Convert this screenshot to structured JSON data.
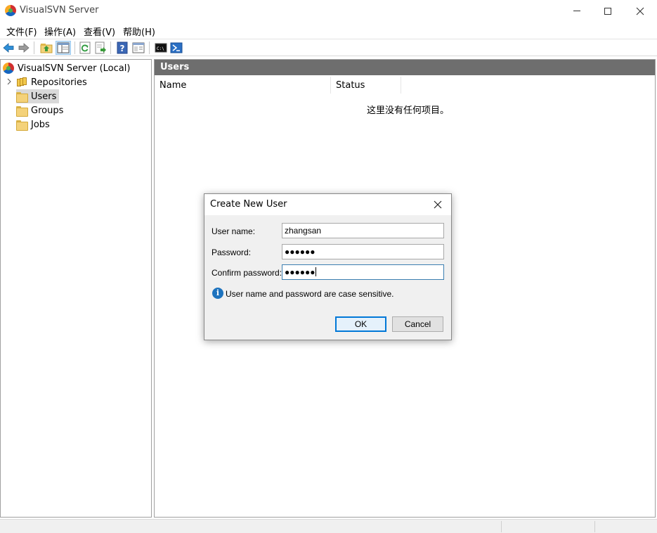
{
  "window": {
    "title": "VisualSVN Server"
  },
  "menu": {
    "items": [
      "文件(F)",
      "操作(A)",
      "查看(V)",
      "帮助(H)"
    ]
  },
  "toolbar": {
    "icons": [
      "back-arrow-icon",
      "forward-arrow-icon",
      "up-folder-icon",
      "show-hide-tree-icon",
      "refresh-icon",
      "export-icon",
      "help-icon",
      "properties-icon",
      "console-icon",
      "powershell-icon"
    ]
  },
  "tree": {
    "root": "VisualSVN Server (Local)",
    "items": [
      {
        "label": "Repositories"
      },
      {
        "label": "Users"
      },
      {
        "label": "Groups"
      },
      {
        "label": "Jobs"
      }
    ],
    "selected": "Users"
  },
  "main": {
    "header": "Users",
    "columns": [
      "Name",
      "Status"
    ],
    "empty_message": "这里没有任何项目。"
  },
  "dialog": {
    "title": "Create New User",
    "username_label": "User name:",
    "username_value": "zhangsan",
    "password_label": "Password:",
    "password_value": "●●●●●●",
    "confirm_label": "Confirm password:",
    "confirm_value": "●●●●●●",
    "info_text": "User name and password are case sensitive.",
    "ok_label": "OK",
    "cancel_label": "Cancel"
  },
  "colors": {
    "header_bg": "#6e6e6e",
    "info_blue": "#1e73be",
    "focus_border": "#0078d7"
  }
}
